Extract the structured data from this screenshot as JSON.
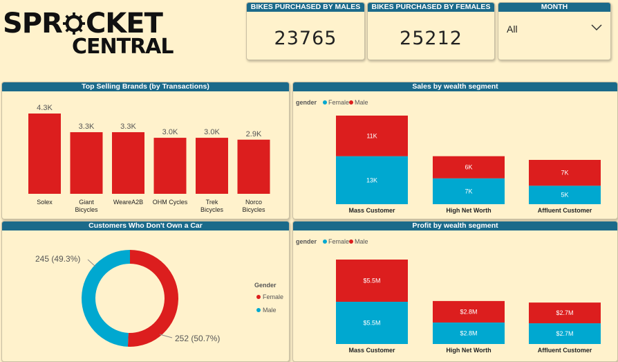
{
  "logo": {
    "line1_a": "SPR",
    "line1_b": "CKET",
    "line2": "CENTRAL"
  },
  "kpis": [
    {
      "label": "BIKES PURCHASED BY MALES",
      "value": "23765"
    },
    {
      "label": "BIKES PURCHASED BY FEMALES",
      "value": "25212"
    }
  ],
  "slicer": {
    "label": "MONTH",
    "value": "All",
    "icon": "chevron-down-icon"
  },
  "colors": {
    "female": "#00a8d0",
    "male": "#dc1e1e",
    "header": "#1b6a8a",
    "bg": "#fff2cc"
  },
  "charts": {
    "brands_title": "Top Selling Brands (by Transactions)",
    "sales_title": "Sales by wealth segment",
    "donut_title": "Customers Who Don't Own a Car",
    "profit_title": "Profit by wealth segment"
  },
  "chart_data": [
    {
      "type": "bar",
      "title": "Top Selling Brands (by Transactions)",
      "categories": [
        "Solex",
        "Giant Bicycles",
        "WeareA2B",
        "OHM Cycles",
        "Trek Bicycles",
        "Norco Bicycles"
      ],
      "values": [
        4300,
        3300,
        3300,
        3000,
        3000,
        2900
      ],
      "data_labels": [
        "4.3K",
        "3.3K",
        "3.3K",
        "3.0K",
        "3.0K",
        "2.9K"
      ],
      "color": "#dc1e1e"
    },
    {
      "type": "bar",
      "stacked": true,
      "title": "Sales by wealth segment",
      "legend_title": "gender",
      "legend_position": "top-left",
      "categories": [
        "Mass Customer",
        "High Net Worth",
        "Affluent Customer"
      ],
      "series": [
        {
          "name": "Female",
          "values": [
            13000,
            7000,
            5000
          ],
          "labels": [
            "13K",
            "7K",
            "5K"
          ],
          "color": "#00a8d0"
        },
        {
          "name": "Male",
          "values": [
            11000,
            6000,
            7000
          ],
          "labels": [
            "11K",
            "6K",
            "7K"
          ],
          "color": "#dc1e1e"
        }
      ]
    },
    {
      "type": "pie",
      "donut": true,
      "title": "Customers Who Don't Own a Car",
      "legend_title": "Gender",
      "legend_position": "right",
      "categories": [
        "Female",
        "Male"
      ],
      "values": [
        252,
        245
      ],
      "data_labels": [
        "252 (50.7%)",
        "245 (49.3%)"
      ],
      "colors": [
        "#dc1e1e",
        "#00a8d0"
      ]
    },
    {
      "type": "bar",
      "stacked": true,
      "title": "Profit by wealth segment",
      "legend_title": "gender",
      "legend_position": "top-left",
      "categories": [
        "Mass Customer",
        "High Net Worth",
        "Affluent Customer"
      ],
      "series": [
        {
          "name": "Female",
          "values": [
            5.5,
            2.8,
            2.7
          ],
          "labels": [
            "$5.5M",
            "$2.8M",
            "$2.7M"
          ],
          "color": "#00a8d0"
        },
        {
          "name": "Male",
          "values": [
            5.5,
            2.8,
            2.7
          ],
          "labels": [
            "$5.5M",
            "$2.8M",
            "$2.7M"
          ],
          "color": "#dc1e1e"
        }
      ]
    }
  ]
}
